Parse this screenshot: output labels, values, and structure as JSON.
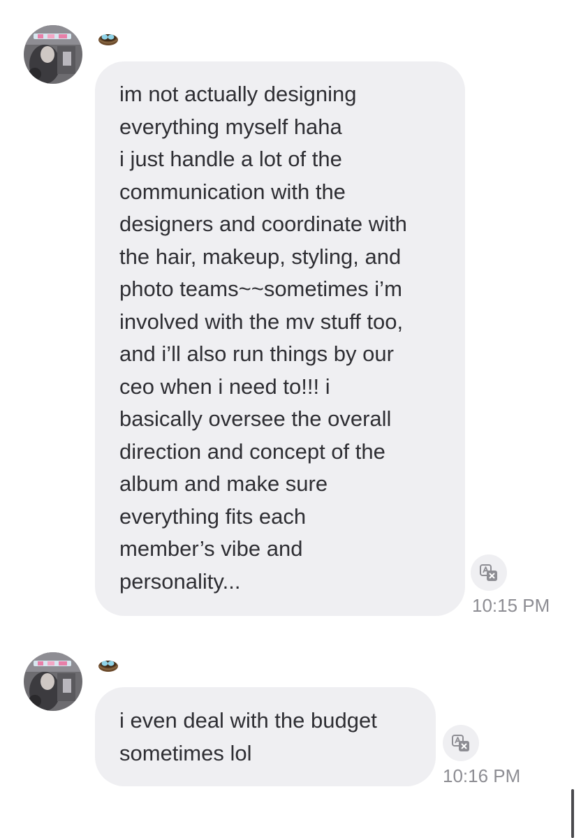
{
  "messages": [
    {
      "avatar_icon": "profile-photo-avatar",
      "nickname_icon": "nest-egg-icon",
      "lines": [
        "im not actually designing",
        "everything myself haha",
        "i just handle a lot of the",
        "communication with the",
        "designers and coordinate with",
        "the hair, makeup, styling, and",
        "photo teams~~sometimes i’m",
        "involved with the mv stuff too,",
        "and i’ll also run things by our",
        "ceo when i need to!!! i",
        "basically oversee the overall",
        "direction and concept of the",
        "album and make sure",
        "everything fits each",
        "member’s vibe and",
        "personality..."
      ],
      "translate_icon": "translate-icon",
      "time": "10:15 PM"
    },
    {
      "avatar_icon": "profile-photo-avatar",
      "nickname_icon": "nest-egg-icon",
      "lines": [
        "i even deal with the budget",
        "sometimes lol"
      ],
      "translate_icon": "translate-icon",
      "time": "10:16 PM"
    }
  ],
  "colors": {
    "bubble": "#efeff2",
    "text": "#2e2e33",
    "timestamp": "#8d8d93",
    "egg": "#8fd3e8",
    "nest": "#6b4a2b"
  }
}
